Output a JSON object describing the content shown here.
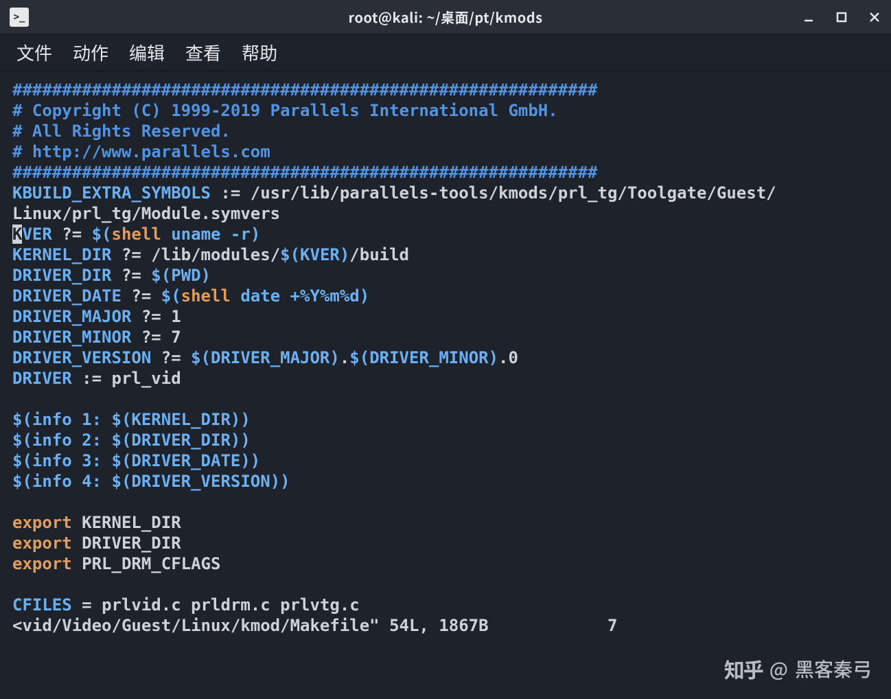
{
  "window": {
    "title": "root@kali: ~/桌面/pt/kmods"
  },
  "menu": {
    "file": "文件",
    "action": "动作",
    "edit": "编辑",
    "view": "查看",
    "help": "帮助"
  },
  "content": {
    "hashline": "###########################################################",
    "copyright1": "# Copyright (C) 1999-2019 Parallels International GmbH.",
    "copyright2": "# All Rights Reserved.",
    "copyright3": "# http://www.parallels.com",
    "kbuild_var": "KBUILD_EXTRA_SYMBOLS",
    "kbuild_assign": " := ",
    "kbuild_path": "/usr/lib/parallels-tools/kmods/prl_tg/Toolgate/Guest/",
    "kbuild_path2": "Linux/prl_tg/Module.symvers",
    "kver_k": "K",
    "kver_rest": "VER",
    "kver_assign": " ?= ",
    "dollar_open": "$(",
    "shell": "shell",
    "space": " ",
    "uname_r": "uname -r",
    "close_paren": ")",
    "kernel_dir": "KERNEL_DIR",
    "qassign": " ?= ",
    "kernel_dir_pre": "/lib/modules/",
    "kver_ref": "$(KVER)",
    "kernel_dir_post": "/build",
    "driver_dir": "DRIVER_DIR",
    "pwd_ref": "$(PWD)",
    "driver_date": "DRIVER_DATE",
    "date_cmd": "date +%Y%m%d",
    "driver_major": "DRIVER_MAJOR",
    "one": "1",
    "driver_minor": "DRIVER_MINOR",
    "seven": "7",
    "driver_version": "DRIVER_VERSION",
    "dv_ref1": "$(DRIVER_MAJOR)",
    "dot": ".",
    "dv_ref2": "$(DRIVER_MINOR)",
    "dotzero": ".0",
    "driver": "DRIVER",
    "cassign": " := ",
    "prl_vid": "prl_vid",
    "info1a": "$(",
    "info1b": "info 1: ",
    "info1c": "$(KERNEL_DIR)",
    "info1d": ")",
    "info2b": "info 2: ",
    "info2c": "$(DRIVER_DIR)",
    "info3b": "info 3: ",
    "info3c": "$(DRIVER_DATE)",
    "info4b": "info 4: ",
    "info4c": "$(DRIVER_VERSION)",
    "export": "export",
    "exp1": " KERNEL_DIR",
    "exp2": " DRIVER_DIR",
    "exp3": " PRL_DRM_CFLAGS",
    "cfiles": "CFILES",
    "eq": " = ",
    "cfiles_list": "prlvid.c prldrm.c prlvtg.c",
    "status_pre": "<vid/Video/Guest/Linux/kmod/Makefile\" 54L, 1867B",
    "status_right": "7"
  },
  "watermark": {
    "brand": "知乎",
    "at": "@",
    "user": "黑客秦弓"
  }
}
